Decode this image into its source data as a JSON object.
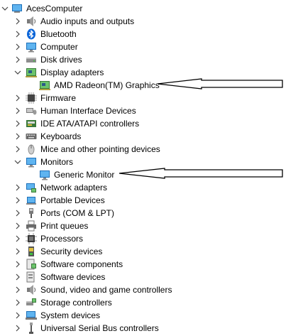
{
  "root": {
    "label": "AcesComputer",
    "expanded": true
  },
  "categories": [
    {
      "label": "Audio inputs and outputs",
      "icon": "speaker-icon",
      "expanded": false
    },
    {
      "label": "Bluetooth",
      "icon": "bluetooth-icon",
      "expanded": false
    },
    {
      "label": "Computer",
      "icon": "monitor-icon",
      "expanded": false
    },
    {
      "label": "Disk drives",
      "icon": "disk-drive-icon",
      "expanded": false
    },
    {
      "label": "Display adapters",
      "icon": "display-adapter-icon",
      "expanded": true,
      "children": [
        {
          "label": "AMD Radeon(TM) Graphics",
          "icon": "display-adapter-icon"
        }
      ]
    },
    {
      "label": "Firmware",
      "icon": "chip-icon",
      "expanded": false
    },
    {
      "label": "Human Interface Devices",
      "icon": "hid-icon",
      "expanded": false
    },
    {
      "label": "IDE ATA/ATAPI controllers",
      "icon": "ide-controller-icon",
      "expanded": false
    },
    {
      "label": "Keyboards",
      "icon": "keyboard-icon",
      "expanded": false
    },
    {
      "label": "Mice and other pointing devices",
      "icon": "mouse-icon",
      "expanded": false
    },
    {
      "label": "Monitors",
      "icon": "monitor-icon",
      "expanded": true,
      "children": [
        {
          "label": "Generic Monitor",
          "icon": "monitor-icon"
        }
      ]
    },
    {
      "label": "Network adapters",
      "icon": "network-adapter-icon",
      "expanded": false
    },
    {
      "label": "Portable Devices",
      "icon": "portable-device-icon",
      "expanded": false
    },
    {
      "label": "Ports (COM & LPT)",
      "icon": "port-icon",
      "expanded": false
    },
    {
      "label": "Print queues",
      "icon": "printer-icon",
      "expanded": false
    },
    {
      "label": "Processors",
      "icon": "processor-icon",
      "expanded": false
    },
    {
      "label": "Security devices",
      "icon": "security-device-icon",
      "expanded": false
    },
    {
      "label": "Software components",
      "icon": "software-component-icon",
      "expanded": false
    },
    {
      "label": "Software devices",
      "icon": "software-device-icon",
      "expanded": false
    },
    {
      "label": "Sound, video and game controllers",
      "icon": "speaker-icon",
      "expanded": false
    },
    {
      "label": "Storage controllers",
      "icon": "storage-controller-icon",
      "expanded": false
    },
    {
      "label": "System devices",
      "icon": "system-device-icon",
      "expanded": false
    },
    {
      "label": "Universal Serial Bus controllers",
      "icon": "usb-icon",
      "expanded": false
    }
  ],
  "colors": {
    "accent": "#0078d7",
    "bluetooth": "#0a64d8",
    "tree_text": "#000000",
    "arrow": "#000000"
  }
}
